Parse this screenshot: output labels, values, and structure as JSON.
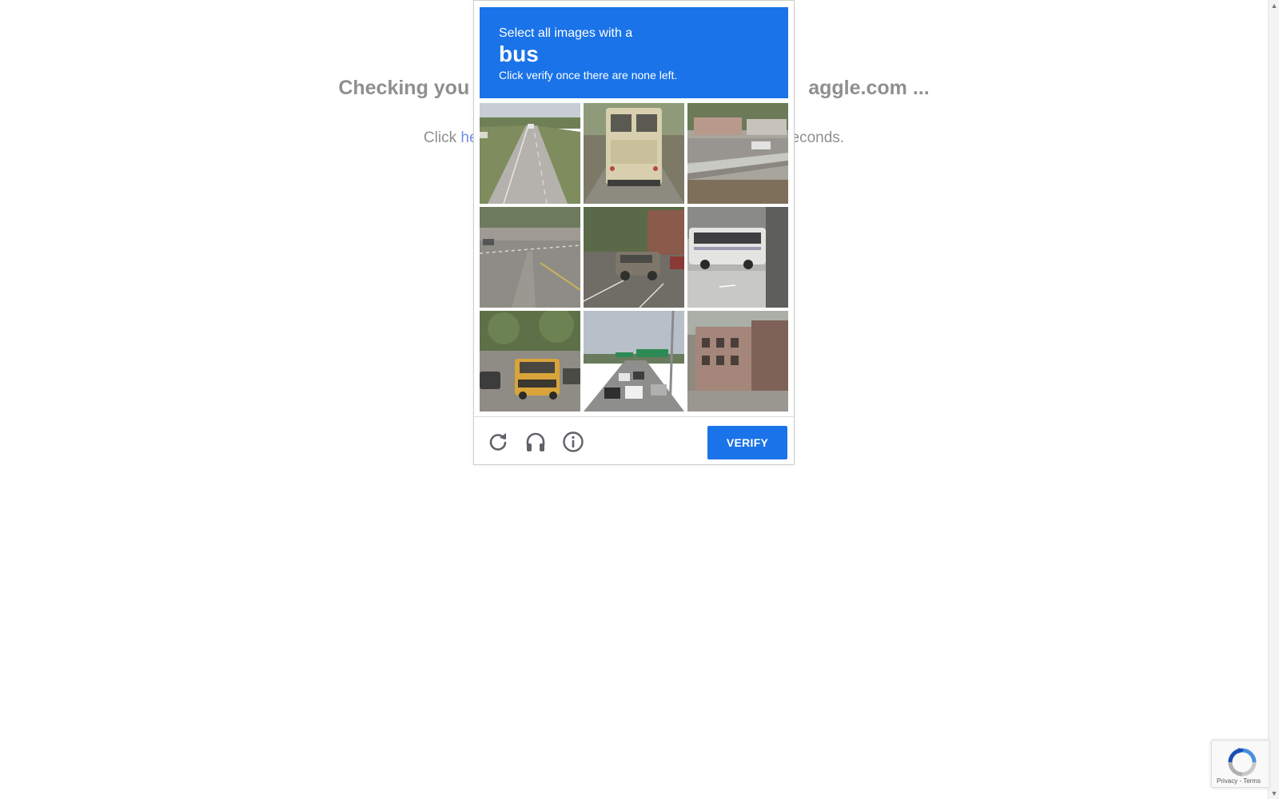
{
  "background": {
    "heading_left": "Checking you",
    "heading_right": "aggle.com ...",
    "sub_prefix": "Click ",
    "sub_link": "he",
    "sub_suffix": "econds."
  },
  "challenge": {
    "prompt_line1": "Select all images with a",
    "prompt_keyword": "bus",
    "prompt_line3": "Click verify once there are none left.",
    "tiles": [
      {
        "scene": "highway"
      },
      {
        "scene": "school-bus-rear"
      },
      {
        "scene": "guardrail-street"
      },
      {
        "scene": "intersection"
      },
      {
        "scene": "parked-suv"
      },
      {
        "scene": "coach-bus"
      },
      {
        "scene": "school-bus-front"
      },
      {
        "scene": "freeway-traffic"
      },
      {
        "scene": "building-street"
      }
    ],
    "footer": {
      "reload_icon": "reload-icon",
      "audio_icon": "headphones-icon",
      "info_icon": "info-icon",
      "verify_label": "VERIFY"
    }
  },
  "badge": {
    "links": "Privacy - Terms"
  },
  "colors": {
    "accent": "#1a73e8",
    "muted_text": "#8f8f8f",
    "link": "#6f8fe6"
  }
}
